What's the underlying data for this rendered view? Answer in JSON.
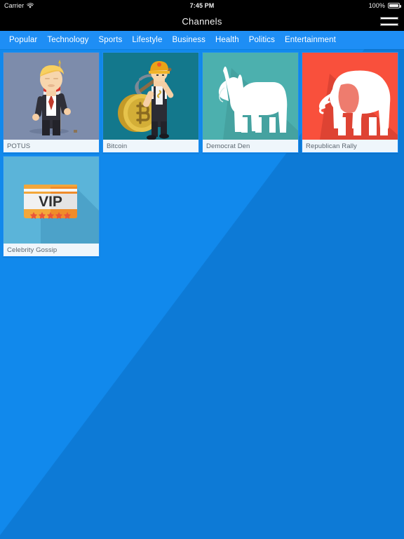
{
  "status_bar": {
    "carrier": "Carrier",
    "wifi_icon": "wifi-icon",
    "time": "7:45 PM",
    "battery_percent": "100%",
    "battery_icon": "battery-full-icon"
  },
  "nav_bar": {
    "title": "Channels",
    "menu_icon": "hamburger-menu-icon"
  },
  "tabs": [
    {
      "label": "Popular"
    },
    {
      "label": "Technology"
    },
    {
      "label": "Sports"
    },
    {
      "label": "Lifestyle"
    },
    {
      "label": "Business"
    },
    {
      "label": "Health"
    },
    {
      "label": "Politics"
    },
    {
      "label": "Entertainment"
    }
  ],
  "channels": [
    {
      "label": "POTUS",
      "thumb_name": "potus-thumbnail",
      "bg": "#7d8cab",
      "art": "president-flag"
    },
    {
      "label": "Bitcoin",
      "thumb_name": "bitcoin-thumbnail",
      "bg": "#13788c",
      "art": "bitcoin-miner"
    },
    {
      "label": "Democrat Den",
      "thumb_name": "democrat-den-thumbnail",
      "bg": "#4cb0ae",
      "art": "donkey"
    },
    {
      "label": "Republican Rally",
      "thumb_name": "republican-rally-thumbnail",
      "bg": "#f9503c",
      "art": "elephant"
    },
    {
      "label": "Celebrity Gossip",
      "thumb_name": "celebrity-gossip-thumbnail",
      "bg": "#5bb4d9",
      "art": "vip-card"
    }
  ],
  "colors": {
    "tab_bar": "#1e8ef5",
    "background_light": "#1189ec",
    "background_dark": "#0d7ad6",
    "status_bar": "#000000",
    "card_label_bg": "#eff6fb"
  }
}
